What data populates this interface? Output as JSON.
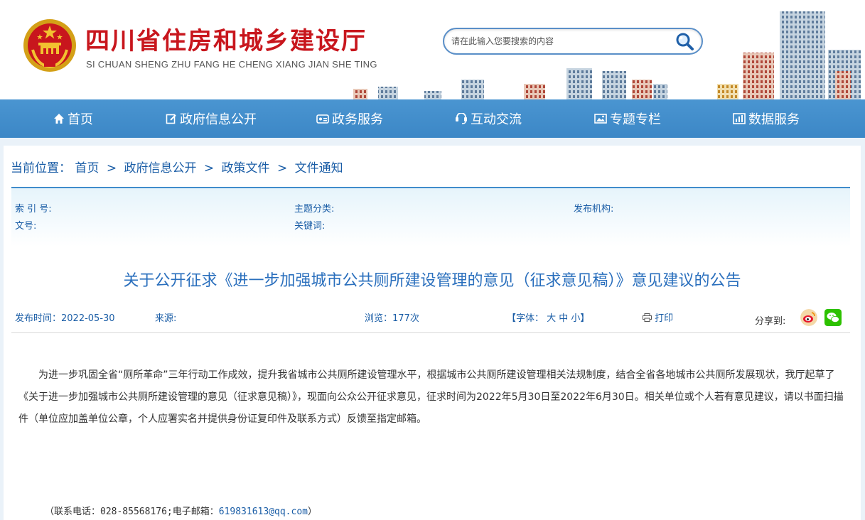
{
  "site": {
    "title": "四川省住房和城乡建设厅",
    "subtitle": "SI CHUAN SHENG ZHU FANG HE CHENG XIANG JIAN SHE TING"
  },
  "search": {
    "placeholder": "请在此输入您要搜索的内容",
    "button_icon": "magnifier-icon"
  },
  "nav": {
    "items": [
      {
        "label": "首页",
        "icon": "home-icon"
      },
      {
        "label": "政府信息公开",
        "icon": "edit-icon"
      },
      {
        "label": "政务服务",
        "icon": "service-icon"
      },
      {
        "label": "互动交流",
        "icon": "interaction-icon"
      },
      {
        "label": "专题专栏",
        "icon": "image-icon"
      },
      {
        "label": "数据服务",
        "icon": "chart-icon"
      }
    ]
  },
  "breadcrumb": {
    "label": "当前位置：",
    "items": [
      "首页",
      "政府信息公开",
      "政策文件",
      "文件通知"
    ],
    "separator": ">"
  },
  "meta": {
    "index_label": "索 引 号:",
    "topic_label": "主题分类:",
    "publisher_label": "发布机构:",
    "doc_no_label": "文号:",
    "keywords_label": "关键词:"
  },
  "article": {
    "title": "关于公开征求《进一步加强城市公共厕所建设管理的意见（征求意见稿）》意见建议的公告",
    "publish_time": "发布时间：2022-05-30",
    "source": "来源:",
    "views": "浏览：177次",
    "font_size": "【字体：  大  中  小】",
    "print": "打印",
    "share_label": "分享到:",
    "body": "为进一步巩固全省“厕所革命”三年行动工作成效，提升我省城市公共厕所建设管理水平，根据城市公共厕所建设管理相关法规制度，结合全省各地城市公共厕所发展现状，我厅起草了《关于进一步加强城市公共厕所建设管理的意见（征求意见稿）》，现面向公众公开征求意见，征求时间为2022年5月30日至2022年6月30日。相关单位或个人若有意见建议，请以书面扫描件（单位应加盖单位公章，个人应署实名并提供身份证复印件及联系方式）反馈至指定邮箱。",
    "contact_prefix": "（联系电话：028-85568176;电子邮箱：",
    "contact_email": "619831613@qq.com",
    "contact_suffix": "）"
  },
  "colors": {
    "brand_red": "#c8161d",
    "nav_blue": "#3c87c6",
    "link_blue": "#1a5da6",
    "title_blue": "#2a6fbd"
  }
}
